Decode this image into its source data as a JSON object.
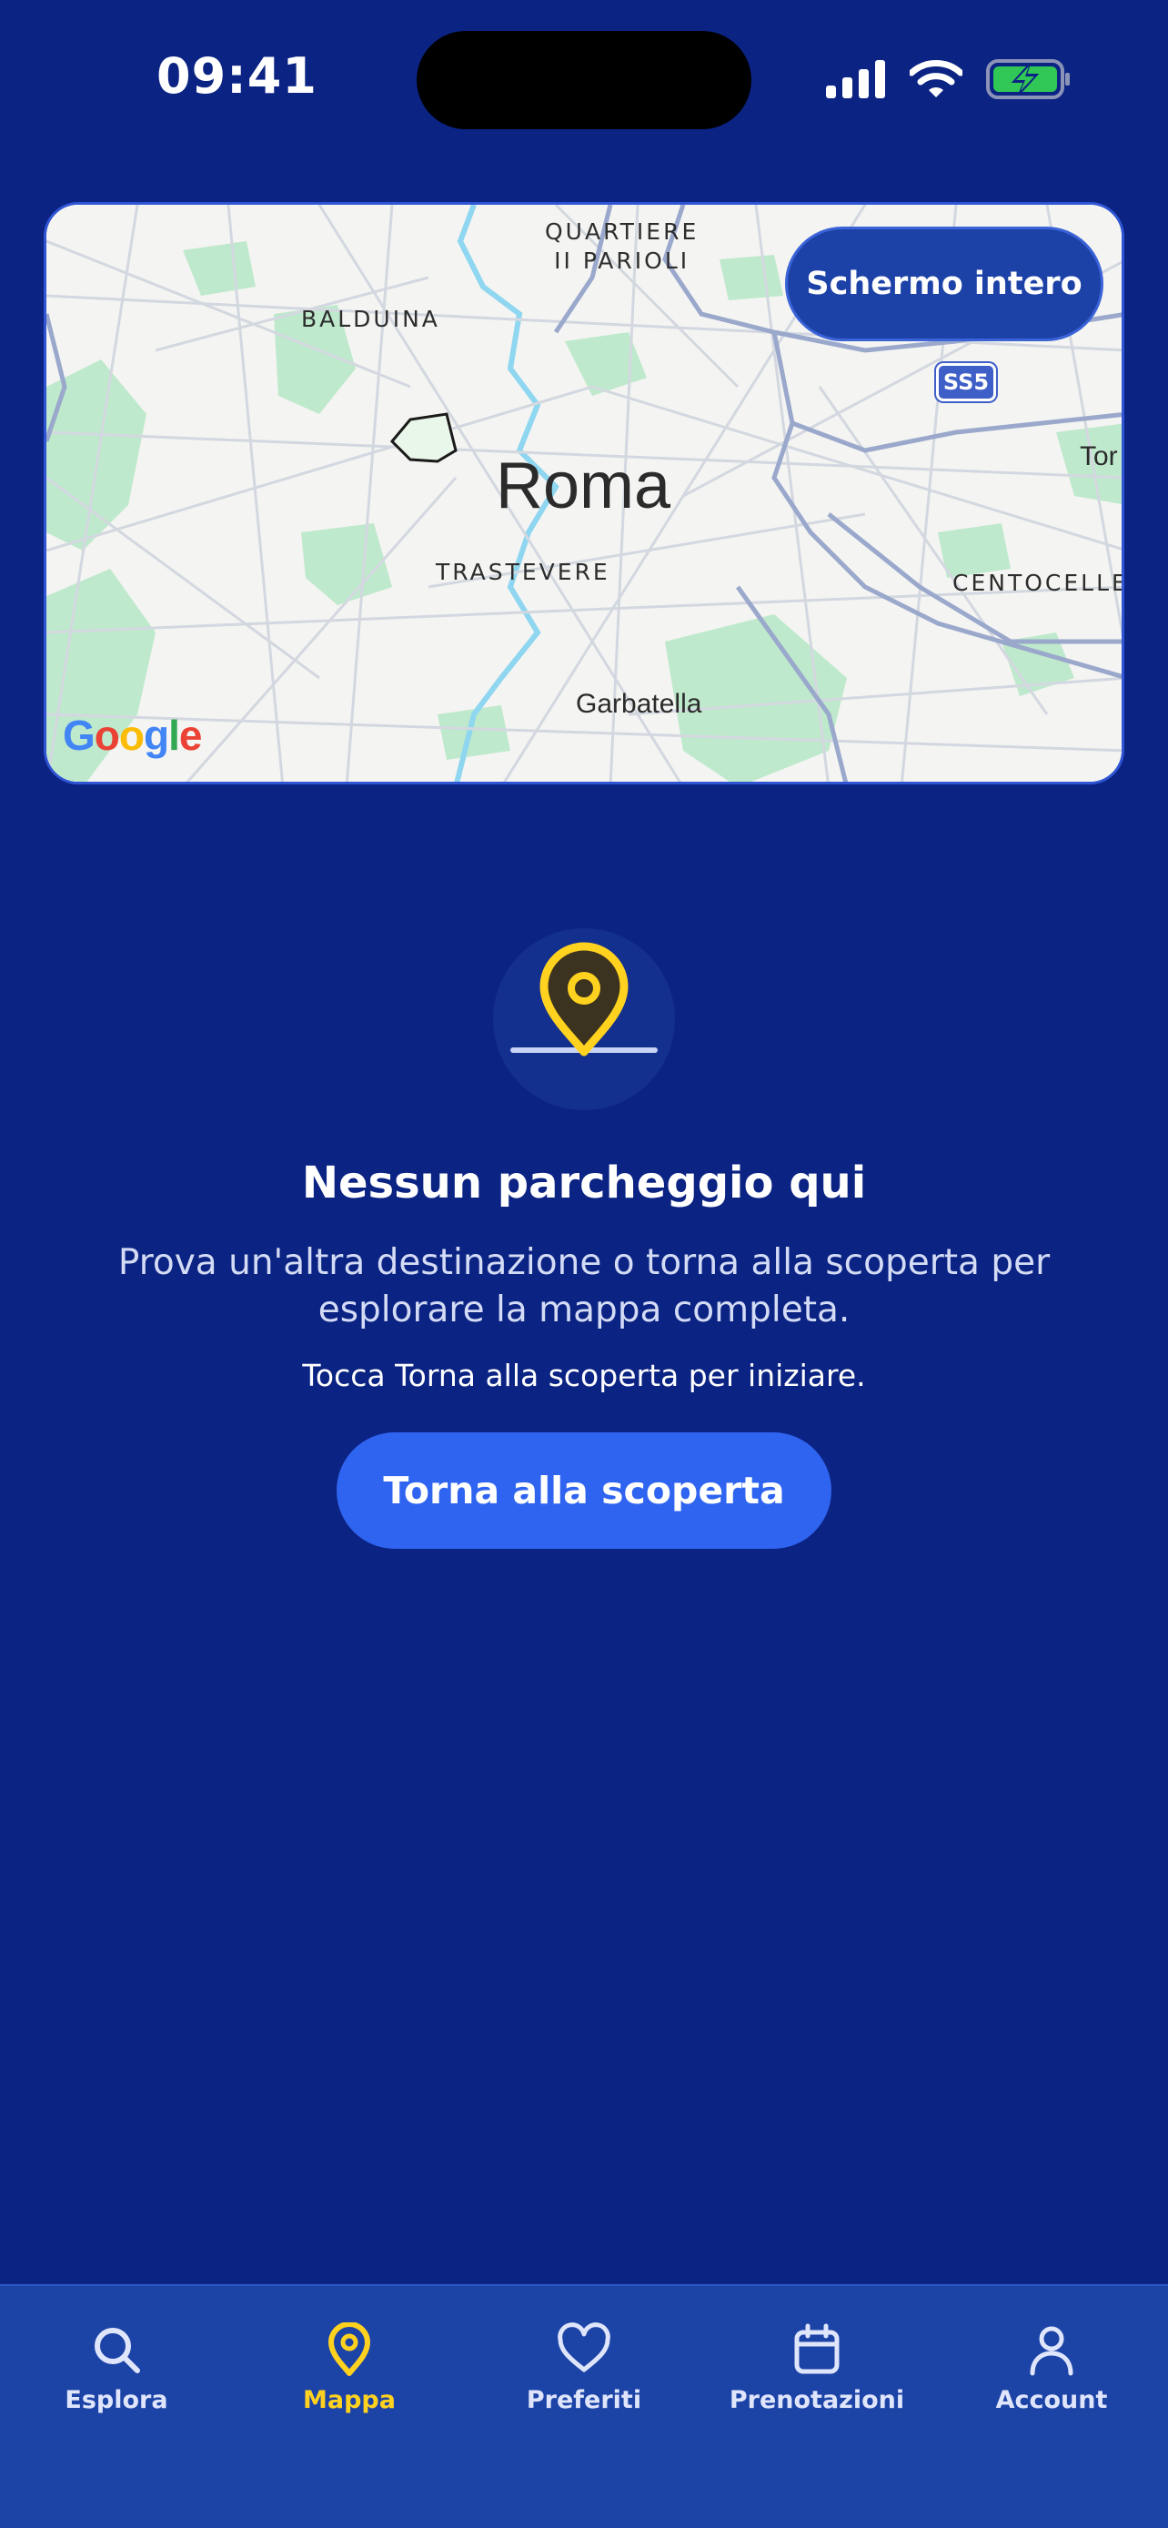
{
  "status_bar": {
    "time": "09:41"
  },
  "map": {
    "city_label": "Roma",
    "neighborhoods": [
      "QUARTIERE II PARIOLI",
      "BALDUINA",
      "TRASTEVERE",
      "CENTOCELLE"
    ],
    "quartiere_line1": "QUARTIERE",
    "quartiere_line2": "II PARIOLI",
    "balduina": "BALDUINA",
    "trastevere": "TRASTEVERE",
    "centocelle": "CENTOCELLE",
    "garbatella": "Garbatella",
    "tor": "Tor",
    "road_badge": "SS5",
    "attribution": "Google",
    "fullscreen_button": "Schermo intero"
  },
  "empty_state": {
    "icon": "map-pin-icon",
    "title": "Nessun parcheggio qui",
    "description": "Prova un'altra destinazione o torna alla scoperta per esplorare la mappa completa.",
    "hint": "Tocca Torna alla scoperta per iniziare.",
    "button": "Torna alla scoperta"
  },
  "tab_bar": {
    "active_color": "#ffd21f",
    "items": [
      {
        "label": "Esplora",
        "icon": "search-icon"
      },
      {
        "label": "Mappa",
        "icon": "map-pin-icon"
      },
      {
        "label": "Preferiti",
        "icon": "heart-icon"
      },
      {
        "label": "Prenotazioni",
        "icon": "calendar-icon"
      },
      {
        "label": "Account",
        "icon": "person-icon"
      }
    ]
  }
}
